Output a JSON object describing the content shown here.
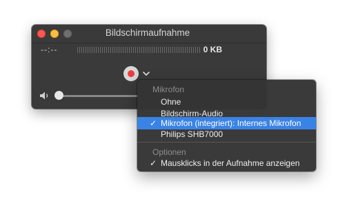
{
  "window": {
    "title": "Bildschirmaufnahme",
    "time": "--:--",
    "file_size": "0 KB"
  },
  "controls": {
    "record_icon": "record-icon",
    "options_icon": "chevron-down-icon",
    "volume_icon": "speaker-icon",
    "volume_level": 0
  },
  "menu": {
    "section_microphone": "Mikrofon",
    "items": [
      {
        "label": "Ohne",
        "checked": false,
        "selected": false
      },
      {
        "label": "Bildschirm-Audio",
        "checked": false,
        "selected": false
      },
      {
        "label": "Mikrofon (integriert): Internes Mikrofon",
        "checked": true,
        "selected": true
      },
      {
        "label": "Philips SHB7000",
        "checked": false,
        "selected": false
      }
    ],
    "section_options": "Optionen",
    "options": [
      {
        "label": "Mausklicks in der Aufnahme anzeigen",
        "checked": true
      }
    ],
    "check_mark": "✓"
  },
  "colors": {
    "selection": "#3a83e6",
    "record": "#f03b3b",
    "close": "#fc5753",
    "minimize": "#fdbc40"
  }
}
